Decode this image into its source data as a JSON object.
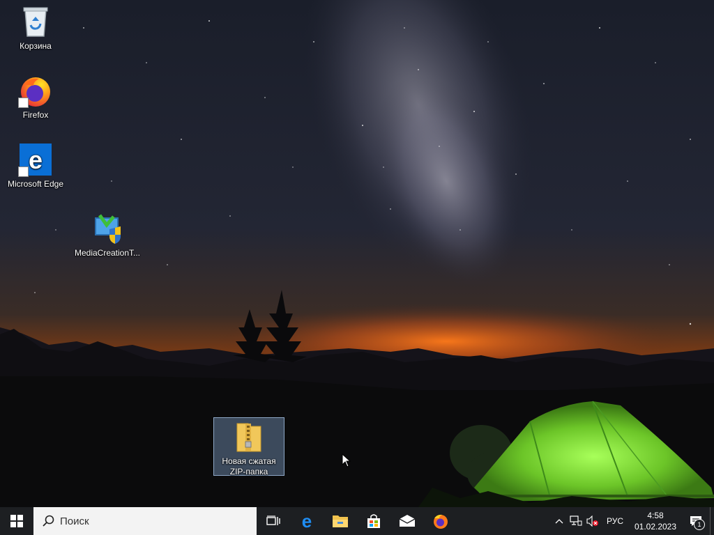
{
  "desktop": {
    "icons": [
      {
        "label": "Корзина"
      },
      {
        "label": "Firefox"
      },
      {
        "label": "Microsoft Edge"
      },
      {
        "label": "MediaCreationT..."
      },
      {
        "label": "Новая сжатая ZIP-папка"
      }
    ]
  },
  "taskbar": {
    "search_placeholder": "Поиск",
    "pinned": [
      "task-view",
      "edge",
      "file-explorer",
      "store",
      "mail",
      "firefox"
    ],
    "tray": {
      "language": "РУС",
      "time": "4:58",
      "date": "01.02.2023",
      "notification_count": "1"
    }
  },
  "colors": {
    "taskbar": "#1d1f22",
    "search_bg": "#f3f3f3",
    "tent": "#7bd73a",
    "selection": "#7896be"
  }
}
